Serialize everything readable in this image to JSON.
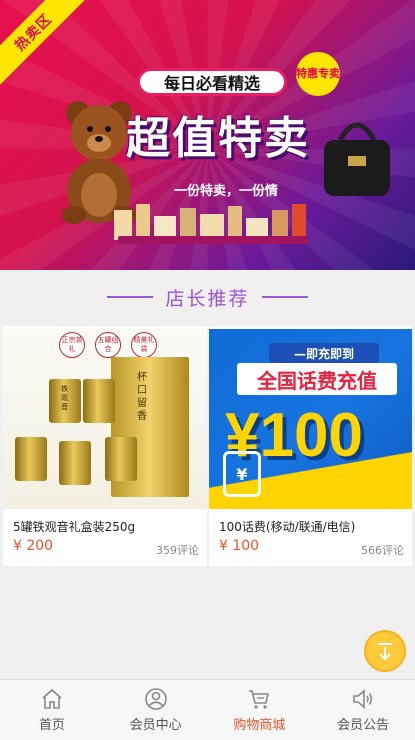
{
  "banner": {
    "corner_tag": "热卖区",
    "subtitle": "每日必看精选",
    "badge": "特惠专卖",
    "title": "超值特卖",
    "slogan": "一份特卖，一份情"
  },
  "section": {
    "title": "店长推荐"
  },
  "products": [
    {
      "name": "5罐铁观音礼盒装250g",
      "price": "¥ 200",
      "reviews": "359评论",
      "image": {
        "badges": [
          "正宗茶礼",
          "五罐组合",
          "精美礼袋"
        ],
        "box_text": "杯口留香",
        "can_text": "铁观音"
      }
    },
    {
      "name": "100话费(移动/联通/电信)",
      "price": "¥ 100",
      "reviews": "566评论",
      "image": {
        "top_text": "—即充即到",
        "title": "全国话费充值",
        "amount": "¥100"
      }
    }
  ],
  "tabbar": {
    "items": [
      {
        "label": "首页",
        "icon": "home-icon",
        "active": false
      },
      {
        "label": "会员中心",
        "icon": "user-icon",
        "active": false
      },
      {
        "label": "购物商城",
        "icon": "cart-icon",
        "active": true
      },
      {
        "label": "会员公告",
        "icon": "speaker-icon",
        "active": false
      }
    ]
  },
  "colors": {
    "accent": "#e8552a",
    "section_title": "#9a56d4",
    "scroll_top": "#ffc93a"
  }
}
